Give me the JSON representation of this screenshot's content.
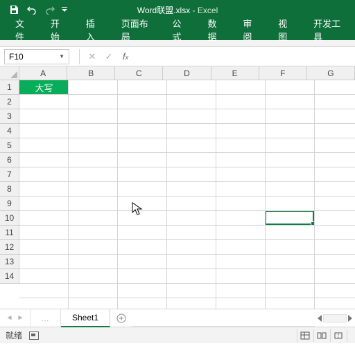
{
  "title": {
    "filename": "Word联盟.xlsx",
    "app": "Excel"
  },
  "ribbon_tabs": [
    "文件",
    "开始",
    "插入",
    "页面布局",
    "公式",
    "数据",
    "审阅",
    "视图",
    "开发工具"
  ],
  "name_box": "F10",
  "formula": "",
  "columns": [
    "A",
    "B",
    "C",
    "D",
    "E",
    "F",
    "G"
  ],
  "rows": [
    "1",
    "2",
    "3",
    "4",
    "5",
    "6",
    "7",
    "8",
    "9",
    "10",
    "11",
    "12",
    "13",
    "14"
  ],
  "cells": {
    "A1": "大写"
  },
  "active_cell": "F10",
  "sheet_tabs": [
    "Sheet1"
  ],
  "status": "就绪",
  "chart_data": null
}
